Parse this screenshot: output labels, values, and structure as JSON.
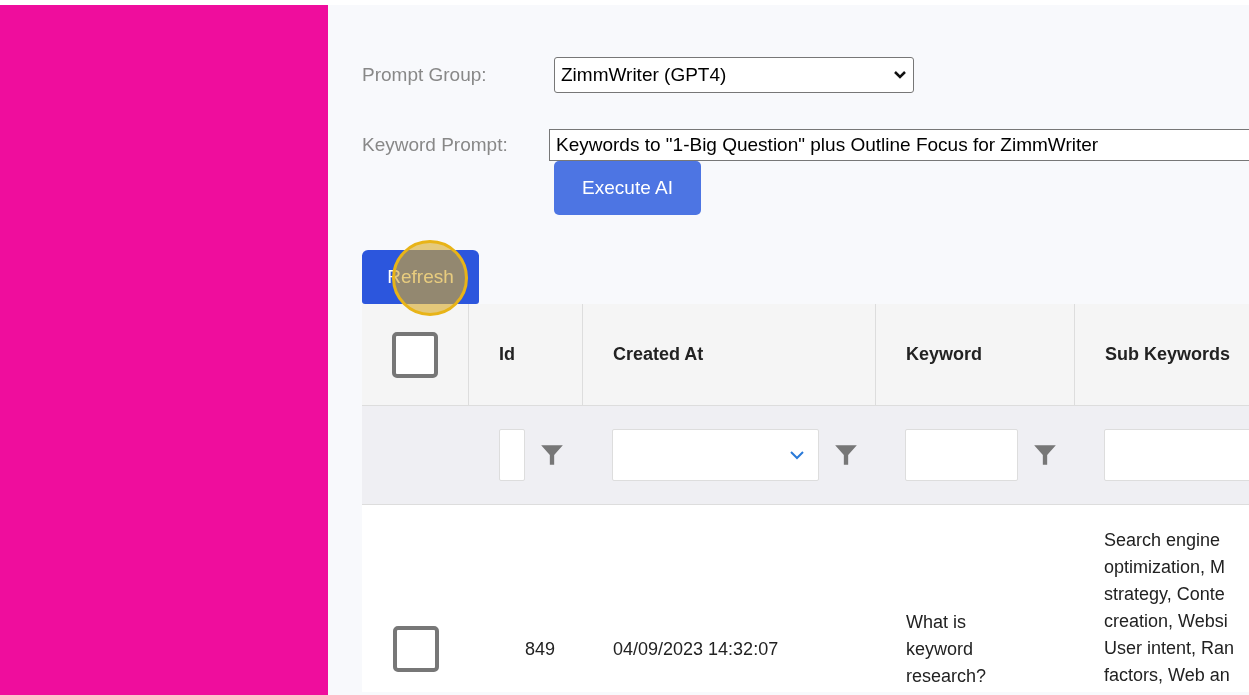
{
  "form": {
    "prompt_group": {
      "label": "Prompt Group:",
      "value": "ZimmWriter (GPT4)"
    },
    "keyword_prompt": {
      "label": "Keyword Prompt:",
      "value": "Keywords to \"1-Big Question\" plus Outline Focus for ZimmWriter"
    },
    "execute_button": "Execute AI"
  },
  "refresh_button": "Refresh",
  "table": {
    "select_all": {
      "checked": false
    },
    "columns": [
      "Id",
      "Created At",
      "Keyword",
      "Sub Keywords"
    ],
    "rows": [
      {
        "checked": false,
        "id": "849",
        "created_at": "04/09/2023 14:32:07",
        "keyword": "What is keyword research?",
        "sub_keywords": [
          "Search engine",
          "optimization, M",
          "strategy, Conte",
          "creation, Websi",
          "User intent, Ran",
          "factors, Web an"
        ]
      }
    ]
  }
}
